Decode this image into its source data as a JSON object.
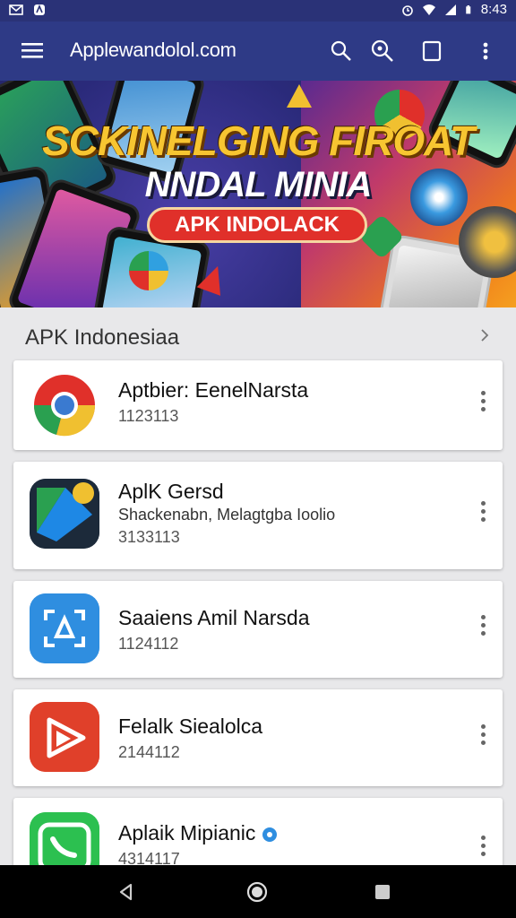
{
  "status_bar": {
    "time": "8:43"
  },
  "app_bar": {
    "title": "Applewandolol.com"
  },
  "banner": {
    "line1": "SCKINELGING FIROAT",
    "line2": "NNDAL MINIA",
    "pill": "APK INDOLACK"
  },
  "section": {
    "title": "APK Indonesiaa"
  },
  "apps": [
    {
      "name": "Aptbier: EenelNarsta",
      "subtitle": "",
      "count": "1123113"
    },
    {
      "name": "AplK Gersd",
      "subtitle": "Shackenabn, Melagtgba Ioolio",
      "count": "3133113"
    },
    {
      "name": "Saaiens Amil Narsda",
      "subtitle": "",
      "count": "1124112"
    },
    {
      "name": "Felalk Siealolca",
      "subtitle": "",
      "count": "2144112"
    },
    {
      "name": "Aplaik Mipianic",
      "subtitle": "",
      "count": "4314117"
    }
  ],
  "colors": {
    "status_bar": "#2a3277",
    "app_bar": "#2e3a86",
    "background": "#e8e8ea",
    "card": "#ffffff"
  }
}
